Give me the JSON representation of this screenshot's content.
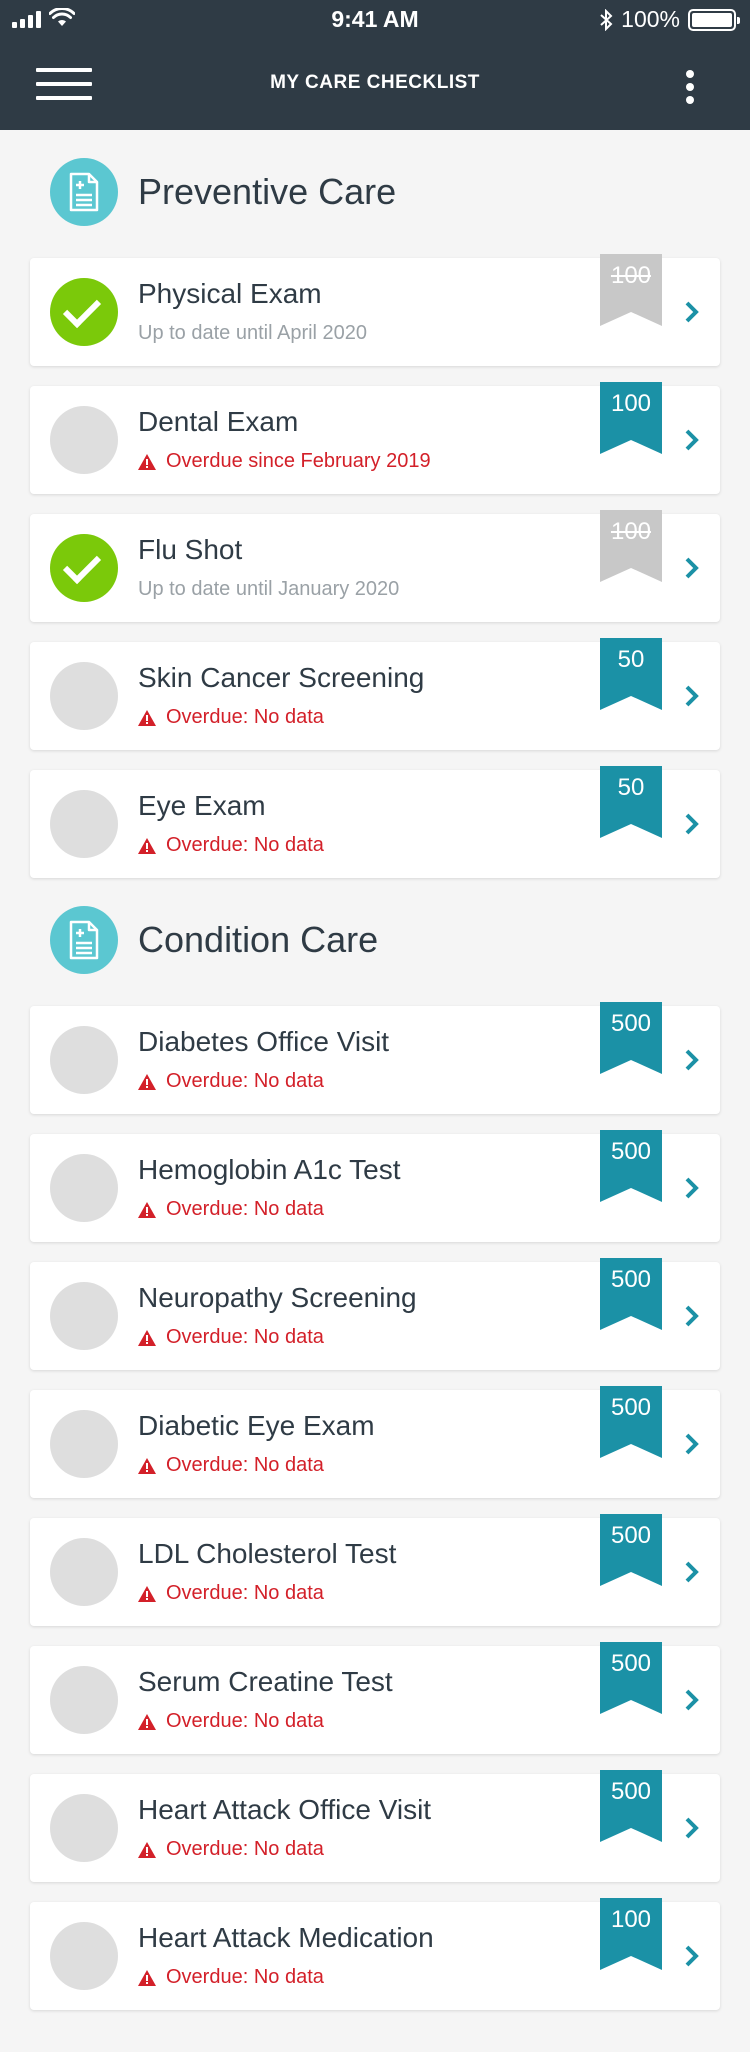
{
  "status_bar": {
    "time": "9:41 AM",
    "battery": "100%"
  },
  "nav": {
    "title": "MY CARE CHECKLIST",
    "menu_icon": "hamburger-menu-icon",
    "more_icon": "vertical-dots-icon"
  },
  "colors": {
    "header": "#2f3b45",
    "accent": "#1b91a6",
    "complete": "#7bc90a",
    "overdue": "#d32029",
    "muted_badge": "#c8c8c8",
    "section_icon": "#5bc7d1"
  },
  "sections": [
    {
      "title": "Preventive Care",
      "icon": "checklist-document-icon",
      "items": [
        {
          "title": "Physical Exam",
          "subtitle": "Up to date until April 2020",
          "status": "complete",
          "points": "100"
        },
        {
          "title": "Dental Exam",
          "subtitle": "Overdue since February 2019",
          "status": "overdue",
          "points": "100"
        },
        {
          "title": "Flu Shot",
          "subtitle": "Up to date until January 2020",
          "status": "complete",
          "points": "100"
        },
        {
          "title": "Skin Cancer Screening",
          "subtitle": "Overdue: No data",
          "status": "overdue",
          "points": "50"
        },
        {
          "title": "Eye Exam",
          "subtitle": "Overdue: No data",
          "status": "overdue",
          "points": "50"
        }
      ]
    },
    {
      "title": "Condition Care",
      "icon": "checklist-document-icon",
      "items": [
        {
          "title": "Diabetes Office Visit",
          "subtitle": "Overdue: No data",
          "status": "overdue",
          "points": "500"
        },
        {
          "title": "Hemoglobin A1c Test",
          "subtitle": "Overdue: No data",
          "status": "overdue",
          "points": "500"
        },
        {
          "title": "Neuropathy Screening",
          "subtitle": "Overdue: No data",
          "status": "overdue",
          "points": "500"
        },
        {
          "title": "Diabetic Eye Exam",
          "subtitle": "Overdue: No data",
          "status": "overdue",
          "points": "500"
        },
        {
          "title": "LDL Cholesterol Test",
          "subtitle": "Overdue: No data",
          "status": "overdue",
          "points": "500"
        },
        {
          "title": "Serum Creatine Test",
          "subtitle": "Overdue: No data",
          "status": "overdue",
          "points": "500"
        },
        {
          "title": "Heart Attack Office Visit",
          "subtitle": "Overdue: No data",
          "status": "overdue",
          "points": "500"
        },
        {
          "title": "Heart Attack Medication",
          "subtitle": "Overdue: No data",
          "status": "overdue",
          "points": "100"
        }
      ]
    }
  ]
}
